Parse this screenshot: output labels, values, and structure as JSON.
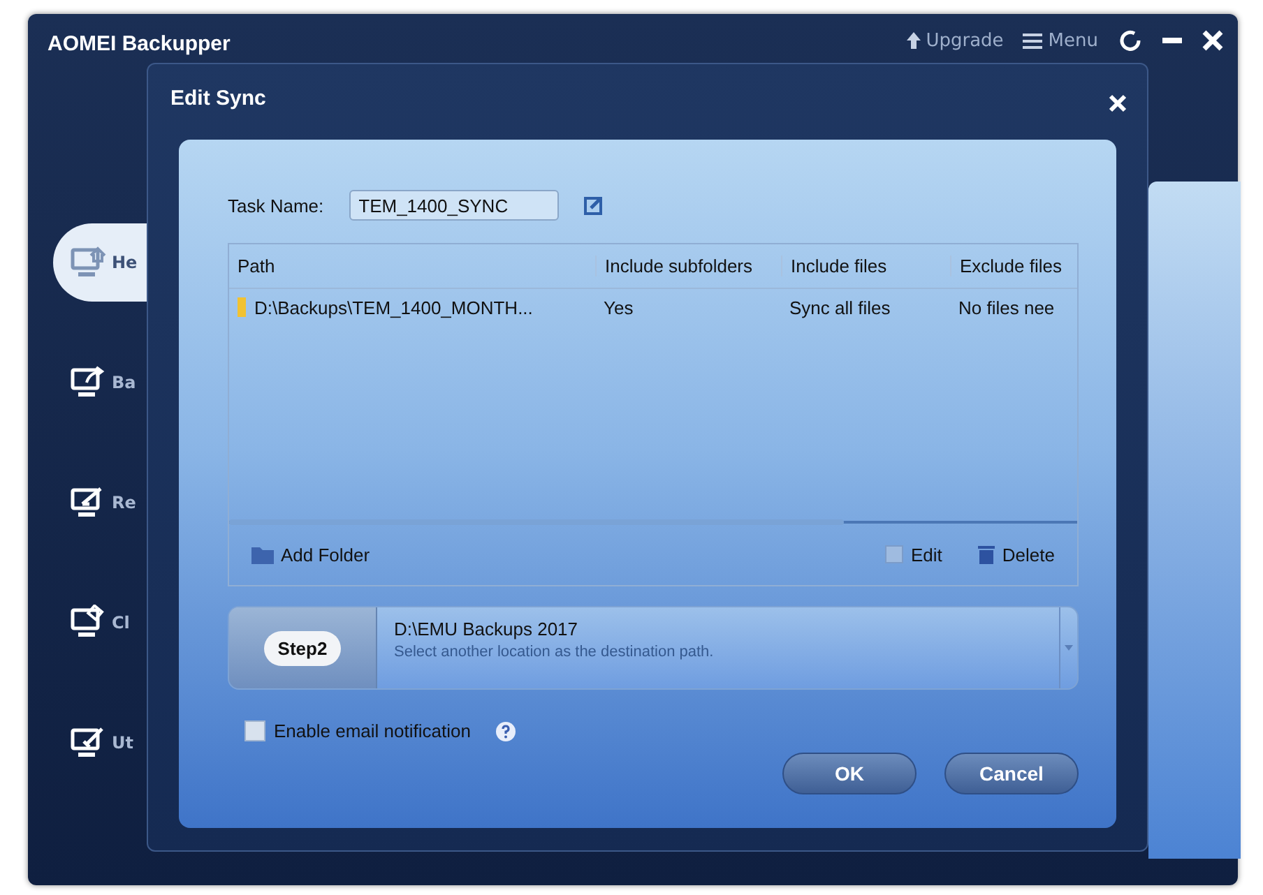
{
  "app_window": {
    "title": "AOMEI Backupper",
    "top_actions": [
      "Upgrade",
      "Menu"
    ],
    "sidebar": [
      {
        "label": "He",
        "selected": true
      },
      {
        "label": "Ba",
        "selected": false
      },
      {
        "label": "Re",
        "selected": false
      },
      {
        "label": "Cl",
        "selected": false
      },
      {
        "label": "Ut",
        "selected": false
      }
    ]
  },
  "dialog": {
    "title": "Edit Sync",
    "task_name_label": "Task Name:",
    "task_name": "TEM_1400_SYNC",
    "table": {
      "columns": [
        "Path",
        "Include subfolders",
        "Include files",
        "Exclude files"
      ],
      "rows": [
        [
          "D:\\Backups\\TEM_1400_MONTH...",
          "Yes",
          "Sync all files",
          "No files nee"
        ]
      ]
    },
    "add_folder": "Add Folder",
    "edit": "Edit",
    "delete": "Delete",
    "step": {
      "badge": "Step2",
      "path": "D:\\EMU Backups 2017",
      "hint": "Select another location as the destination path."
    },
    "email": {
      "label": "Enable email notification",
      "checked": false
    },
    "buttons": [
      "OK",
      "Cancel"
    ]
  }
}
